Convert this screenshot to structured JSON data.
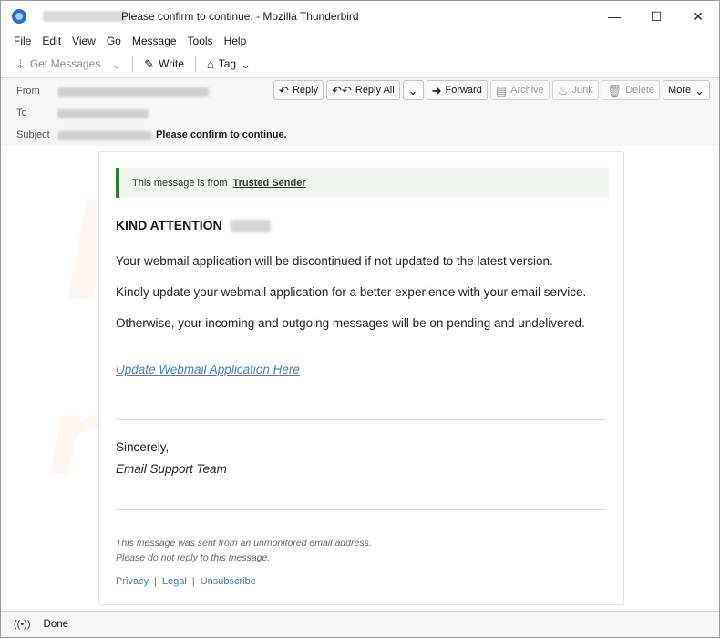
{
  "window": {
    "title": "Please confirm to continue. - Mozilla Thunderbird",
    "controls": {
      "minimize": "—",
      "maximize": "☐",
      "close": "✕"
    }
  },
  "menu": [
    "File",
    "Edit",
    "View",
    "Go",
    "Message",
    "Tools",
    "Help"
  ],
  "toolbar": {
    "get_messages": "Get Messages",
    "write": "Write",
    "tag": "Tag"
  },
  "header": {
    "from_label": "From",
    "to_label": "To",
    "subject_label": "Subject",
    "subject": "Please confirm to continue.",
    "actions": {
      "reply": "Reply",
      "reply_all": "Reply All",
      "forward": "Forward",
      "archive": "Archive",
      "junk": "Junk",
      "delete": "Delete",
      "more": "More"
    }
  },
  "message": {
    "notice_text": "This message is from",
    "notice_sender": "Trusted Sender",
    "heading": "KIND ATTENTION",
    "paragraphs": [
      "Your webmail application will be discontinued if not updated to the latest version.",
      "Kindly update your webmail application for a better experience with your email service.",
      "Otherwise, your incoming and outgoing messages will be on pending and undelivered."
    ],
    "link": "Update Webmail Application Here",
    "sign_off": "Sincerely,",
    "signature": "Email Support Team",
    "footer_lines": [
      "This message was sent from an unmonitored email address.",
      "Please do not reply to this message."
    ],
    "footer_links": [
      "Privacy",
      "Legal",
      "Unsubscribe"
    ],
    "footer_separator": "|"
  },
  "status": {
    "text": "Done"
  },
  "colors": {
    "accent_link": "#3a84bf",
    "notice_border": "#2f7d32",
    "notice_bg": "#eef6ee"
  }
}
